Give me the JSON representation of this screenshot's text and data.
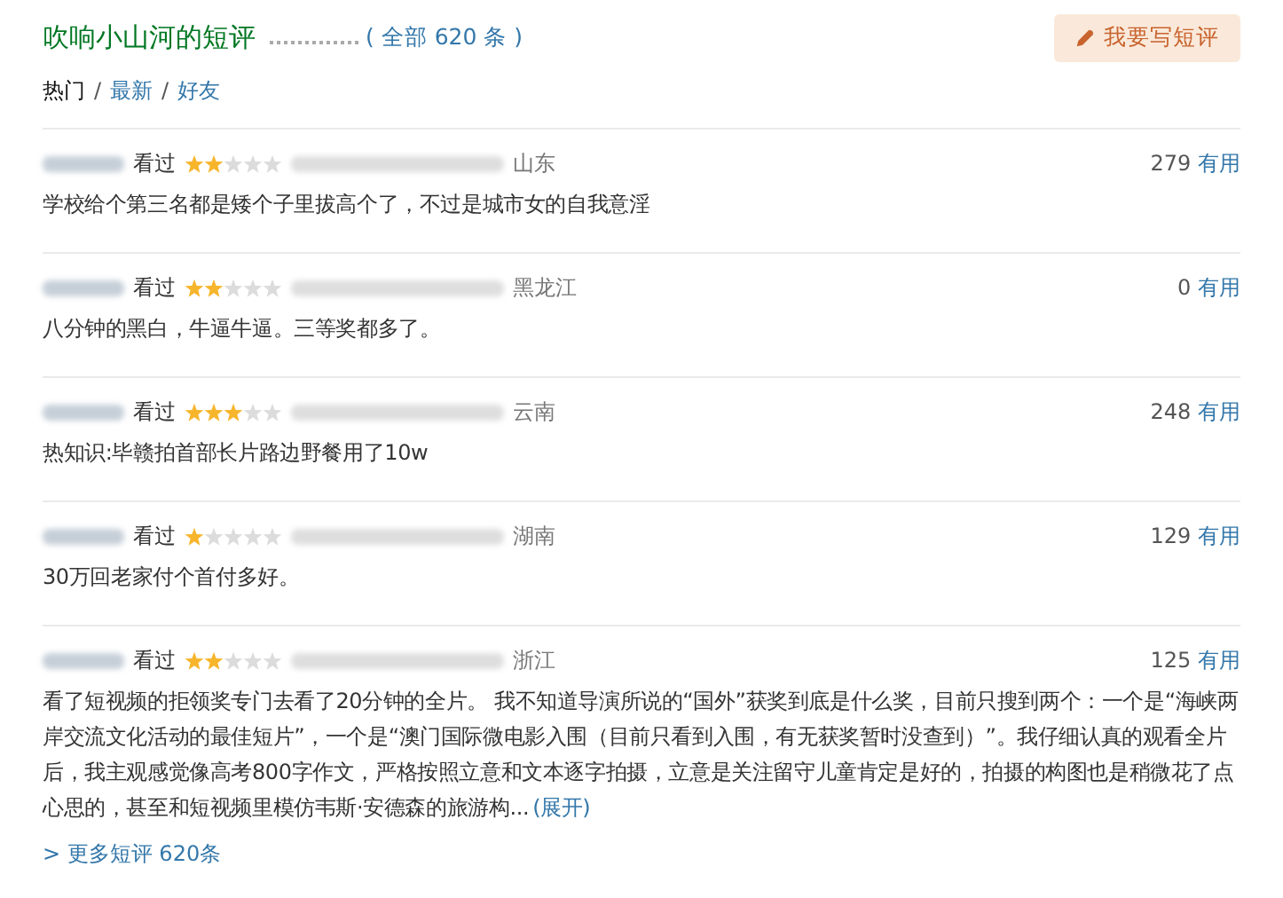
{
  "header": {
    "title": "吹响小山河的短评",
    "total": "( 全部 620 条 )",
    "write_button": "我要写短评"
  },
  "tabs": [
    {
      "label": "热门",
      "selected": true
    },
    {
      "label": "最新",
      "selected": false
    },
    {
      "label": "好友",
      "selected": false
    }
  ],
  "tab_separators": [
    "/",
    "/"
  ],
  "reviews": [
    {
      "status": "看过",
      "stars": 2,
      "location": "山东",
      "votes": "279",
      "votes_label": "有用",
      "text": "学校给个第三名都是矮个子里拔高个了，不过是城市女的自我意淫"
    },
    {
      "status": "看过",
      "stars": 2,
      "location": "黑龙江",
      "votes": "0",
      "votes_label": "有用",
      "text": "八分钟的黑白，牛逼牛逼。三等奖都多了。"
    },
    {
      "status": "看过",
      "stars": 3,
      "location": "云南",
      "votes": "248",
      "votes_label": "有用",
      "text": "热知识:毕赣拍首部长片路边野餐用了10w"
    },
    {
      "status": "看过",
      "stars": 1,
      "location": "湖南",
      "votes": "129",
      "votes_label": "有用",
      "text": "30万回老家付个首付多好。"
    },
    {
      "status": "看过",
      "stars": 2,
      "location": "浙江",
      "votes": "125",
      "votes_label": "有用",
      "text": "看了短视频的拒领奖专门去看了20分钟的全片。 我不知道导演所说的“国外”获奖到底是什么奖，目前只搜到两个：一个是“海峡两岸交流文化活动的最佳短片”，一个是“澳门国际微电影入围（目前只看到入围，有无获奖暂时没查到）”。我仔细认真的观看全片后，我主观感觉像高考800字作文，严格按照立意和文本逐字拍摄，立意是关注留守儿童肯定是好的，拍摄的构图也是稍微花了点心思的，甚至和短视频里模仿韦斯·安德森的旅游构...",
      "expand": "(展开)"
    }
  ],
  "more_link": "> 更多短评 620条"
}
